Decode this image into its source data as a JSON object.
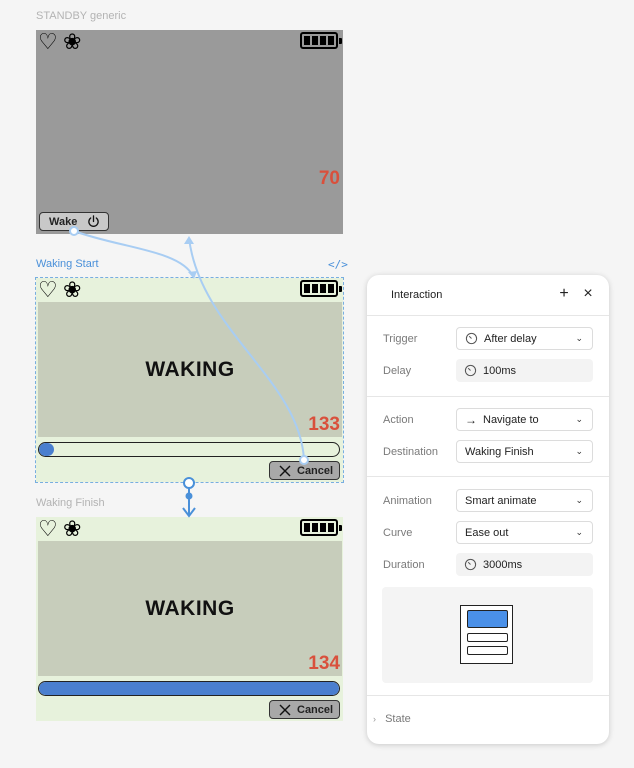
{
  "canvas": {
    "frames": [
      {
        "label": "STANDBY generic",
        "number": "70",
        "battery_cells": 4,
        "button": {
          "label": "Wake",
          "icon": "power-icon"
        }
      },
      {
        "label": "Waking Start",
        "selected": true,
        "code_icon": "</>",
        "screen_title": "WAKING",
        "number": "133",
        "progress_fraction": 0.03,
        "button": {
          "label": "Cancel",
          "icon": "x-icon"
        }
      },
      {
        "label": "Waking Finish",
        "screen_title": "WAKING",
        "number": "134",
        "progress_fraction": 1.0,
        "button": {
          "label": "Cancel",
          "icon": "x-icon"
        }
      }
    ],
    "status_icons": [
      "heart-icon",
      "fan-icon",
      "battery-icon"
    ]
  },
  "panel": {
    "title": "Interaction",
    "trigger": {
      "label": "Trigger",
      "value": "After delay"
    },
    "delay": {
      "label": "Delay",
      "value": "100ms"
    },
    "action": {
      "label": "Action",
      "value": "Navigate to"
    },
    "destination": {
      "label": "Destination",
      "value": "Waking Finish"
    },
    "animation": {
      "label": "Animation",
      "value": "Smart animate"
    },
    "curve": {
      "label": "Curve",
      "value": "Ease out"
    },
    "duration": {
      "label": "Duration",
      "value": "3000ms"
    },
    "state": {
      "label": "State"
    }
  },
  "colors": {
    "accent": "#4a90d9",
    "number": "#d9503c",
    "progress": "#4a7fcf",
    "standby_bg": "#9a9a9a",
    "waking_bg": "#e7f2dc",
    "screen_bg": "#c7cdbb"
  }
}
